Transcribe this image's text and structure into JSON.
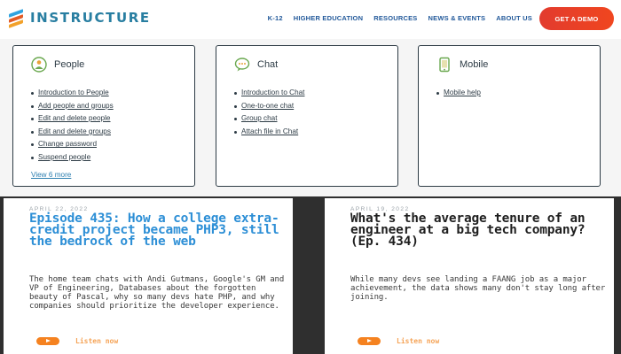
{
  "brand": {
    "name": "INSTRUCTURE"
  },
  "nav": {
    "items": [
      "K-12",
      "HIGHER EDUCATION",
      "RESOURCES",
      "NEWS & EVENTS",
      "ABOUT US"
    ],
    "cta": "GET A DEMO"
  },
  "cards": [
    {
      "title": "People",
      "icon": "person-icon",
      "links": [
        "Introduction to People",
        "Add people and groups",
        "Edit and delete people",
        "Edit and delete groups",
        "Change password",
        "Suspend people"
      ],
      "more": "View 6 more"
    },
    {
      "title": "Chat",
      "icon": "chat-bubble-icon",
      "links": [
        "Introduction to Chat",
        "One-to-one chat",
        "Group chat",
        "Attach file in Chat"
      ]
    },
    {
      "title": "Mobile",
      "icon": "mobile-phone-icon",
      "links": [
        "Mobile help"
      ]
    }
  ],
  "podcasts": [
    {
      "date": "APRIL 22, 2022",
      "title": "Episode 435: How a college extra-credit project became PHP3, still the bedrock of the web",
      "description": "The home team chats with Andi Gutmans, Google's GM and VP of Engineering, Databases about the forgotten beauty of Pascal, why so many devs hate PHP, and why companies should prioritize the developer experience.",
      "listen": "Listen now",
      "title_color": "#2d8fd6"
    },
    {
      "date": "APRIL 19, 2022",
      "title": "What's the average tenure of an engineer at a big tech company? (Ep. 434)",
      "description": "While many devs see landing a FAANG job as a major achievement, the data shows many don't stay long after joining.",
      "listen": "Listen now",
      "title_color": "#1f1f1f"
    }
  ],
  "colors": {
    "brand_blue": "#287ea1",
    "nav_blue": "#22599a",
    "cta_red": "#e23b2e",
    "podcast_orange": "#f58220",
    "dark_band": "#2f2f2f"
  }
}
